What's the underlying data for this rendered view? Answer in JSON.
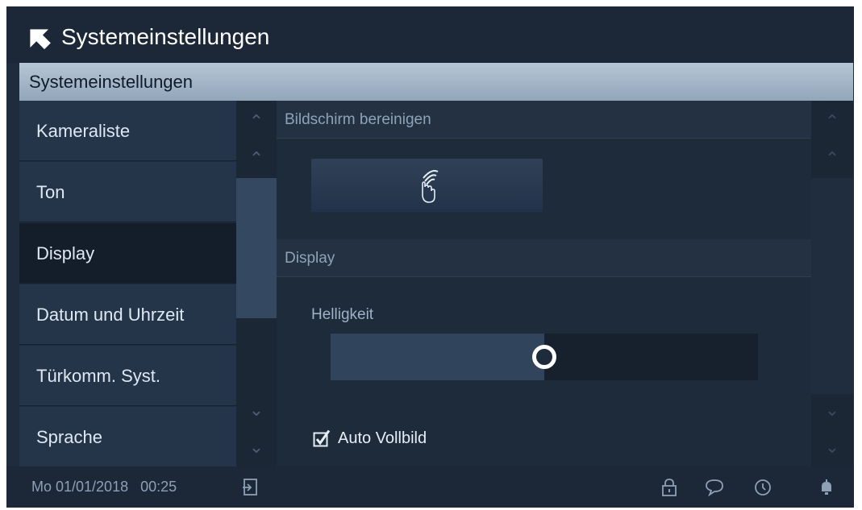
{
  "window": {
    "title": "Systemeinstellungen"
  },
  "section": {
    "title": "Systemeinstellungen"
  },
  "menu": {
    "items": [
      {
        "label": "Kameraliste",
        "selected": false
      },
      {
        "label": "Ton",
        "selected": false
      },
      {
        "label": "Display",
        "selected": true
      },
      {
        "label": "Datum und Uhrzeit",
        "selected": false
      },
      {
        "label": "Türkomm. Syst.",
        "selected": false
      },
      {
        "label": "Sprache",
        "selected": false
      }
    ]
  },
  "content": {
    "groups": {
      "clean_screen": {
        "title": "Bildschirm bereinigen",
        "button_icon": "hand-wave-icon"
      },
      "display": {
        "title": "Display",
        "brightness": {
          "label": "Helligkeit",
          "value_percent": 50
        },
        "auto_fullscreen": {
          "label": "Auto Vollbild",
          "checked": true
        }
      }
    }
  },
  "statusbar": {
    "datetime": "Mo 01/01/2018   00:25",
    "icons": [
      "logout-icon",
      "lock-icon",
      "message-icon",
      "history-icon",
      "bell-icon"
    ]
  },
  "colors": {
    "background": "#1f2c3d",
    "header": "#b6c6d6",
    "menu_item": "#243449",
    "menu_selected": "#141e2b",
    "slider_fill": "#30445c",
    "text": "#dfe8f2",
    "muted": "#8fa3b8"
  }
}
